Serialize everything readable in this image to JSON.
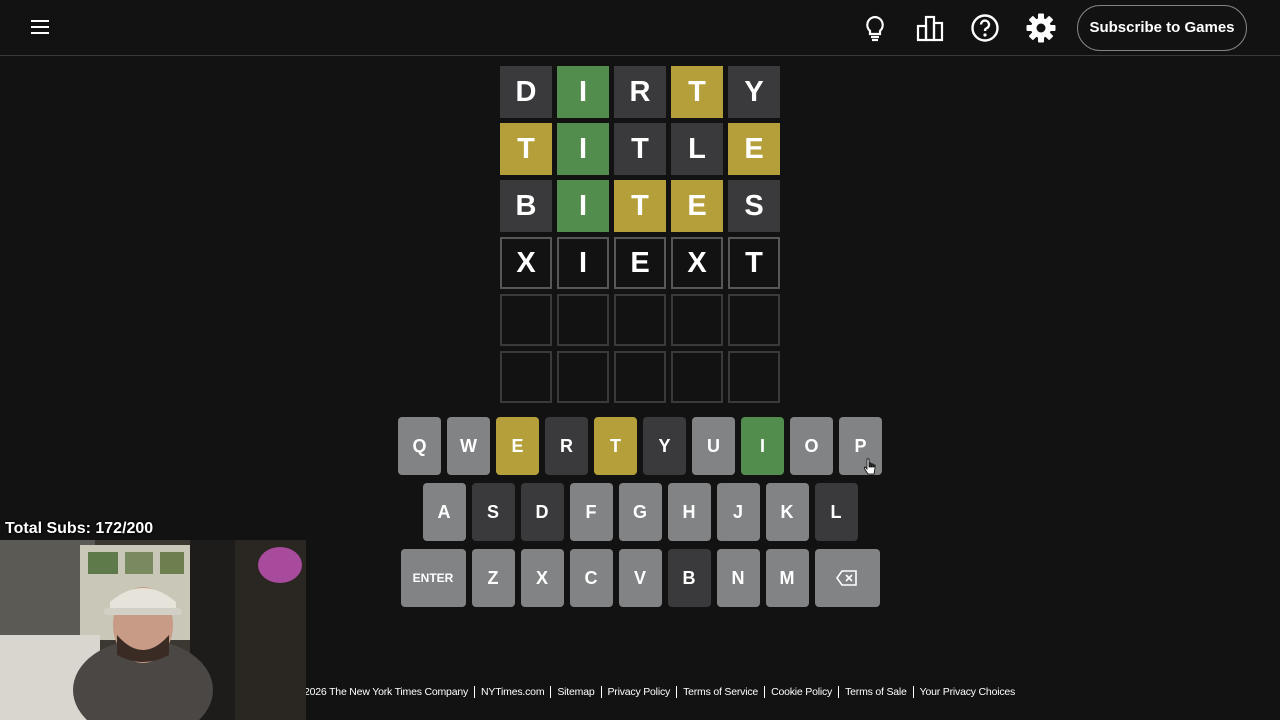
{
  "header": {
    "icons": [
      "hamburger-menu-icon",
      "lightbulb-icon",
      "leaderboard-icon",
      "help-icon",
      "settings-icon"
    ],
    "subscribe_label": "Subscribe to Games"
  },
  "board": {
    "rows": [
      [
        {
          "letter": "D",
          "state": "absent"
        },
        {
          "letter": "I",
          "state": "correct"
        },
        {
          "letter": "R",
          "state": "absent"
        },
        {
          "letter": "T",
          "state": "present"
        },
        {
          "letter": "Y",
          "state": "absent"
        }
      ],
      [
        {
          "letter": "T",
          "state": "present"
        },
        {
          "letter": "I",
          "state": "correct"
        },
        {
          "letter": "T",
          "state": "absent"
        },
        {
          "letter": "L",
          "state": "absent"
        },
        {
          "letter": "E",
          "state": "present"
        }
      ],
      [
        {
          "letter": "B",
          "state": "absent"
        },
        {
          "letter": "I",
          "state": "correct"
        },
        {
          "letter": "T",
          "state": "present"
        },
        {
          "letter": "E",
          "state": "present"
        },
        {
          "letter": "S",
          "state": "absent"
        }
      ],
      [
        {
          "letter": "X",
          "state": "tbd"
        },
        {
          "letter": "I",
          "state": "tbd"
        },
        {
          "letter": "E",
          "state": "tbd"
        },
        {
          "letter": "X",
          "state": "tbd"
        },
        {
          "letter": "T",
          "state": "tbd"
        }
      ],
      [
        {
          "letter": "",
          "state": "empty"
        },
        {
          "letter": "",
          "state": "empty"
        },
        {
          "letter": "",
          "state": "empty"
        },
        {
          "letter": "",
          "state": "empty"
        },
        {
          "letter": "",
          "state": "empty"
        }
      ],
      [
        {
          "letter": "",
          "state": "empty"
        },
        {
          "letter": "",
          "state": "empty"
        },
        {
          "letter": "",
          "state": "empty"
        },
        {
          "letter": "",
          "state": "empty"
        },
        {
          "letter": "",
          "state": "empty"
        }
      ]
    ]
  },
  "keyboard": {
    "rows": [
      [
        {
          "key": "Q",
          "state": "unused"
        },
        {
          "key": "W",
          "state": "unused"
        },
        {
          "key": "E",
          "state": "present"
        },
        {
          "key": "R",
          "state": "absent"
        },
        {
          "key": "T",
          "state": "present"
        },
        {
          "key": "Y",
          "state": "absent"
        },
        {
          "key": "U",
          "state": "unused"
        },
        {
          "key": "I",
          "state": "correct"
        },
        {
          "key": "O",
          "state": "unused"
        },
        {
          "key": "P",
          "state": "unused"
        }
      ],
      [
        {
          "key": "A",
          "state": "unused"
        },
        {
          "key": "S",
          "state": "absent"
        },
        {
          "key": "D",
          "state": "absent"
        },
        {
          "key": "F",
          "state": "unused"
        },
        {
          "key": "G",
          "state": "unused"
        },
        {
          "key": "H",
          "state": "unused"
        },
        {
          "key": "J",
          "state": "unused"
        },
        {
          "key": "K",
          "state": "unused"
        },
        {
          "key": "L",
          "state": "absent"
        }
      ],
      [
        {
          "key": "ENTER",
          "state": "unused",
          "wide": true
        },
        {
          "key": "Z",
          "state": "unused"
        },
        {
          "key": "X",
          "state": "unused"
        },
        {
          "key": "C",
          "state": "unused"
        },
        {
          "key": "V",
          "state": "unused"
        },
        {
          "key": "B",
          "state": "absent"
        },
        {
          "key": "N",
          "state": "unused"
        },
        {
          "key": "M",
          "state": "unused"
        },
        {
          "key": "",
          "state": "unused",
          "wide": true,
          "icon": "backspace-icon"
        }
      ]
    ]
  },
  "colors": {
    "correct": "#538d4e",
    "present": "#b59f3b",
    "absent": "#3a3a3c",
    "unused": "#818384",
    "background": "#121213"
  },
  "footer": {
    "links": [
      "2026 The New York Times Company",
      "NYTimes.com",
      "Sitemap",
      "Privacy Policy",
      "Terms of Service",
      "Cookie Policy",
      "Terms of Sale",
      "Your Privacy Choices"
    ]
  },
  "stream_overlay": {
    "subs_text": "Total Subs: 172/200"
  }
}
